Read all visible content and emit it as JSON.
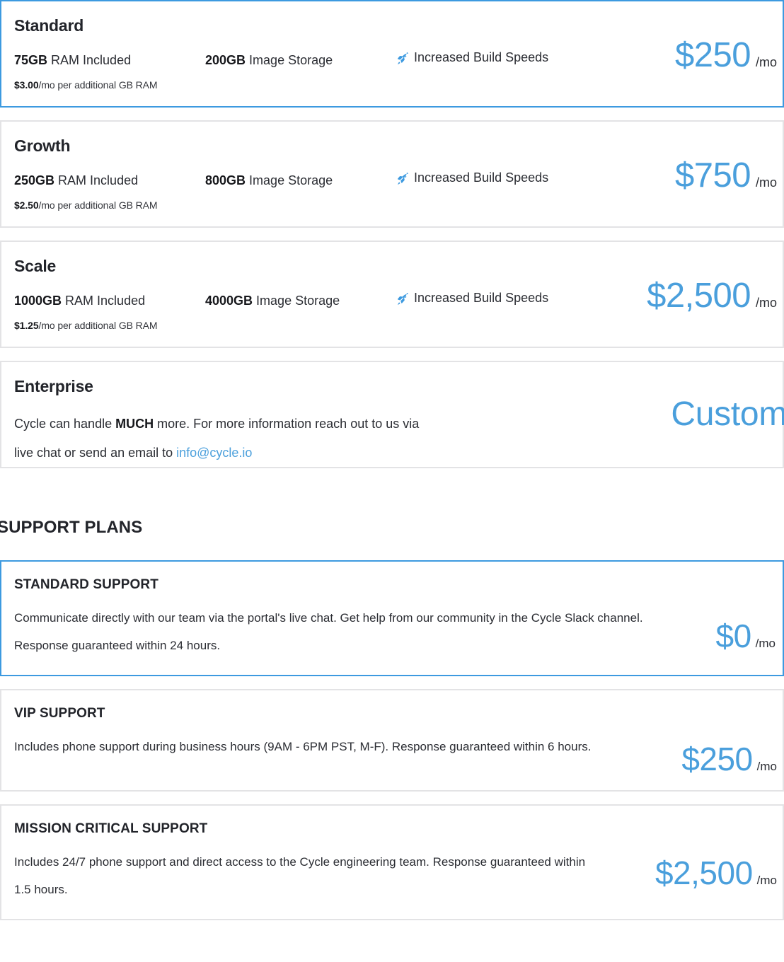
{
  "hosting_plans": [
    {
      "name": "Standard",
      "selected": true,
      "ram_amount": "75GB",
      "ram_label": " RAM Included",
      "storage_amount": "200GB",
      "storage_label": " Image Storage",
      "speed_label": "Increased Build Speeds",
      "speed_icon": "rocket-icon",
      "note_amount": "$3.00",
      "note_label": "/mo per additional GB RAM",
      "price": "$250",
      "price_period": "/mo"
    },
    {
      "name": "Growth",
      "selected": false,
      "ram_amount": "250GB",
      "ram_label": " RAM Included",
      "storage_amount": "800GB",
      "storage_label": " Image Storage",
      "speed_label": "Increased Build Speeds",
      "speed_icon": "rocket-icon",
      "note_amount": "$2.50",
      "note_label": "/mo per additional GB RAM",
      "price": "$750",
      "price_period": "/mo"
    },
    {
      "name": "Scale",
      "selected": false,
      "ram_amount": "1000GB",
      "ram_label": " RAM Included",
      "storage_amount": "4000GB",
      "storage_label": " Image Storage",
      "speed_label": "Increased Build Speeds",
      "speed_icon": "rocket-icon",
      "note_amount": "$1.25",
      "note_label": "/mo per additional GB RAM",
      "price": "$2,500",
      "price_period": "/mo"
    }
  ],
  "enterprise": {
    "name": "Enterprise",
    "selected": false,
    "text_before": "Cycle can handle ",
    "emphasis": "MUCH",
    "text_middle": " more. For more information reach out to us via live chat or send an email to ",
    "email": "info@cycle.io",
    "price": "Custom"
  },
  "support_section": {
    "heading": "SUPPORT PLANS",
    "plans": [
      {
        "name": "STANDARD SUPPORT",
        "selected": true,
        "description": "Communicate directly with our team via the portal's live chat. Get help from our community in the Cycle Slack channel. Response guaranteed within 24 hours.",
        "price": "$0",
        "price_period": "/mo"
      },
      {
        "name": "VIP SUPPORT",
        "selected": false,
        "description": "Includes phone support during business hours (9AM - 6PM PST, M-F). Response guaranteed within 6 hours.",
        "price": "$250",
        "price_period": "/mo"
      },
      {
        "name": "MISSION CRITICAL SUPPORT",
        "selected": false,
        "description": "Includes 24/7 phone support and direct access to the Cycle engineering team. Response guaranteed within 1.5 hours.",
        "price": "$2,500",
        "price_period": "/mo"
      }
    ]
  },
  "colors": {
    "accent": "#3d9ae0",
    "price": "#4a9fdc",
    "link": "#4a9fdc",
    "border": "#e3e3e5",
    "text": "#22242a"
  }
}
